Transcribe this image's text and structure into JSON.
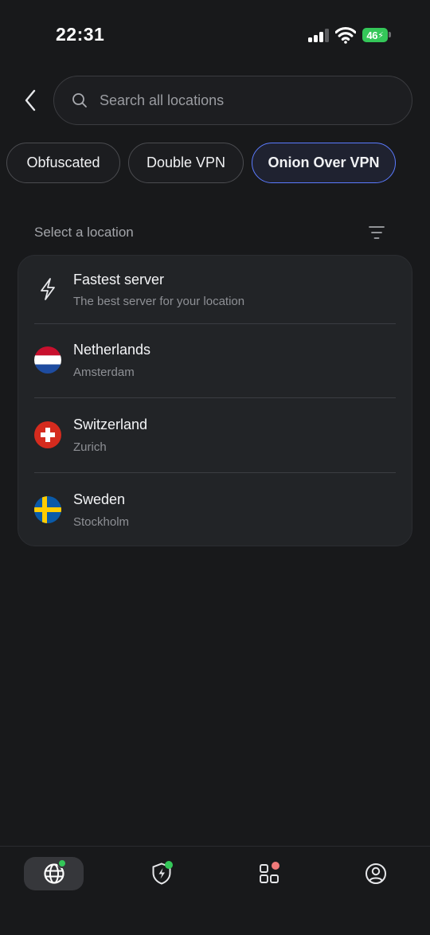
{
  "status_bar": {
    "time": "22:31",
    "battery": "46"
  },
  "search": {
    "placeholder": "Search all locations"
  },
  "chips": [
    {
      "label": "Obfuscated",
      "active": false
    },
    {
      "label": "Double VPN",
      "active": false
    },
    {
      "label": "Onion Over VPN",
      "active": true
    }
  ],
  "section": {
    "title": "Select a location"
  },
  "locations": [
    {
      "title": "Fastest server",
      "subtitle": "The best server for your location",
      "icon": "lightning-icon"
    },
    {
      "title": "Netherlands",
      "subtitle": "Amsterdam",
      "icon": "netherlands-flag-icon"
    },
    {
      "title": "Switzerland",
      "subtitle": "Zurich",
      "icon": "switzerland-flag-icon"
    },
    {
      "title": "Sweden",
      "subtitle": "Stockholm",
      "icon": "sweden-flag-icon"
    }
  ],
  "bottom_nav": [
    {
      "icon": "globe-icon",
      "active": true,
      "badge_color": "#34c759"
    },
    {
      "icon": "shield-bolt-icon",
      "active": false,
      "badge_color": "#34c759"
    },
    {
      "icon": "apps-grid-icon",
      "active": false,
      "badge_color": "#f07a7a"
    },
    {
      "icon": "profile-icon",
      "active": false
    }
  ],
  "colors": {
    "accent": "#5b7bff",
    "background": "#18191b",
    "card": "#222427"
  }
}
